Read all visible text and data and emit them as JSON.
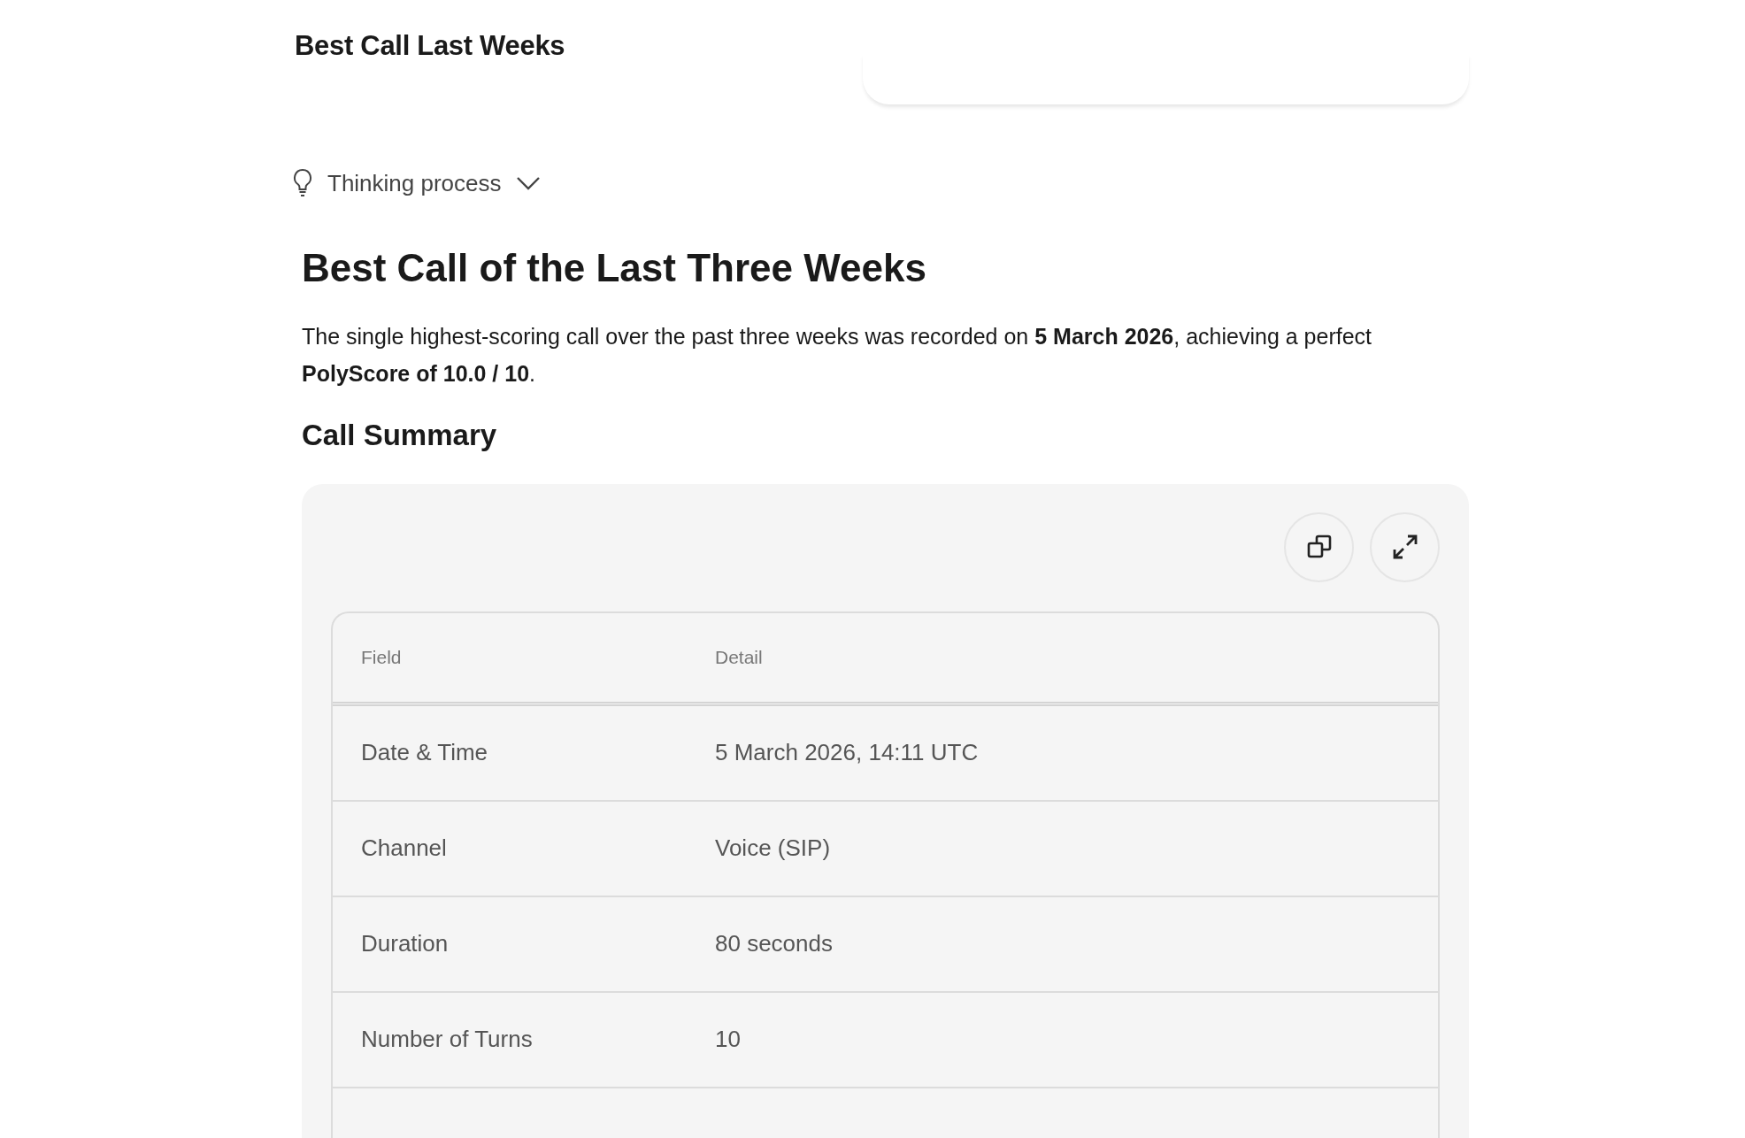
{
  "page_title": "Best Call Last Weeks",
  "thinking": {
    "label": "Thinking process",
    "expanded": false
  },
  "heading": "Best Call of the Last Three Weeks",
  "intro": "The single highest-scoring call over the past three weeks was recorded on **5 March 2026**, achieving a perfect **PolyScore of 10.0 / 10**.",
  "section_heading": "Call Summary",
  "table": {
    "columns": [
      "Field",
      "Detail"
    ],
    "rows": [
      [
        "Date & Time",
        "5 March 2026, 14:11 UTC"
      ],
      [
        "Channel",
        "Voice (SIP)"
      ],
      [
        "Duration",
        "80 seconds"
      ],
      [
        "Number of Turns",
        "10"
      ]
    ]
  }
}
